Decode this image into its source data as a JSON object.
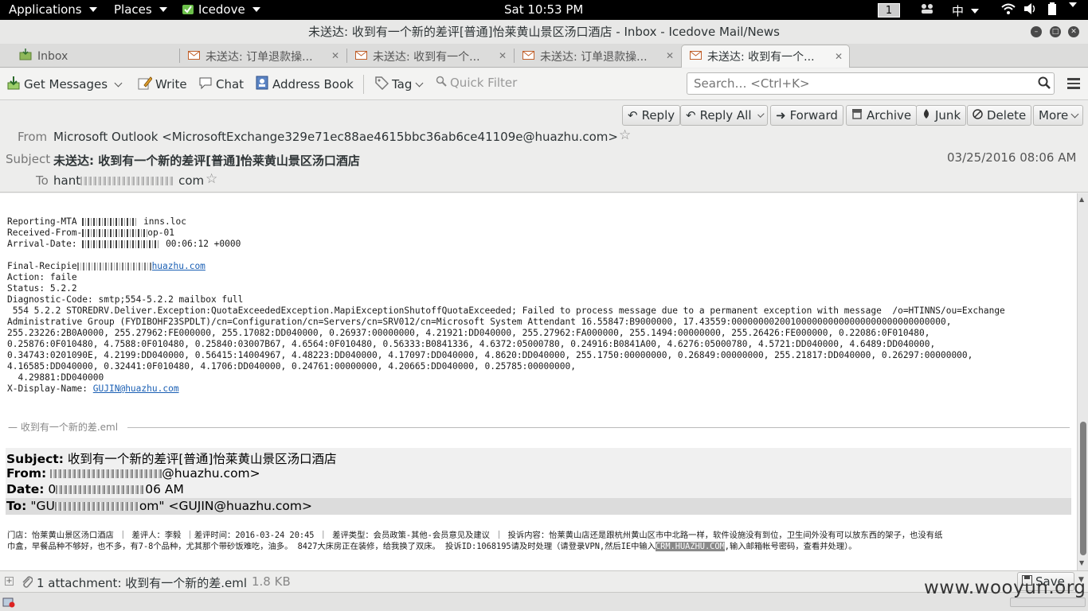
{
  "topbar": {
    "applications": "Applications",
    "places": "Places",
    "app_name": "Icedove",
    "clock": "Sat 10:53 PM",
    "workspace": "1",
    "input_method": "中"
  },
  "window": {
    "title": "未送达: 收到有一个新的差评[普通]怡莱黄山景区汤口酒店 - Inbox - Icedove Mail/News"
  },
  "tabs": [
    {
      "label": "Inbox"
    },
    {
      "label": "未送达: 订单退款操..."
    },
    {
      "label": "未送达: 收到有一个..."
    },
    {
      "label": "未送达: 订单退款操..."
    },
    {
      "label": "未送达: 收到有一个..."
    }
  ],
  "toolbar": {
    "get_messages": "Get Messages",
    "write": "Write",
    "chat": "Chat",
    "address_book": "Address Book",
    "tag": "Tag",
    "quick_filter": "Quick Filter",
    "search_placeholder": "Search… <Ctrl+K>"
  },
  "header_buttons": {
    "reply": "Reply",
    "reply_all": "Reply All",
    "forward": "Forward",
    "archive": "Archive",
    "junk": "Junk",
    "delete": "Delete",
    "more": "More"
  },
  "message_header": {
    "from_label": "From",
    "from_value": "Microsoft Outlook <MicrosoftExchange329e71ec88ae4615bbc36ab6ce41109e@huazhu.com>",
    "subject_label": "Subject",
    "subject_value": "未送达: 收到有一个新的差评[普通]怡莱黄山景区汤口酒店",
    "date": "03/25/2016 08:06 AM",
    "to_label": "To",
    "to_prefix": "hant",
    "to_suffix": "com"
  },
  "body": {
    "reporting_mta": "Reporting-MTA",
    "reporting_mta_tail": "inns.loc",
    "received_from": "Received-From-",
    "received_from_tail": "op-01",
    "arrival_date": "Arrival-Date:",
    "arrival_date_tail": "00:06:12 +0000",
    "final_recipient": "Final-Recipie",
    "final_recipient_link": "huazhu.com",
    "action": "Action: faile",
    "status": "Status: 5.2.2",
    "diagnostic": "Diagnostic-Code: smtp;554-5.2.2 mailbox full",
    "diag_lines": [
      " 554 5.2.2 STOREDRV.Deliver.Exception:QuotaExceededException.MapiExceptionShutoffQuotaExceeded; Failed to process message due to a permanent exception with message  /o=HTINNS/ou=Exchange",
      "Administrative Group (FYDIBOHF23SPDLT)/cn=Configuration/cn=Servers/cn=SRV012/cn=Microsoft System Attendant 16.55847:B9000000, 17.43559:0000000020010000000000000000000000000000,",
      "255.23226:2B0A0000, 255.27962:FE000000, 255.17082:DD040000, 0.26937:00000000, 4.21921:DD040000, 255.27962:FA000000, 255.1494:00000000, 255.26426:FE000000, 0.22086:0F010480,",
      "0.25876:0F010480, 4.7588:0F010480, 0.25840:03007B67, 4.6564:0F010480, 0.56333:B0841336, 4.6372:05000780, 0.24916:B0841A00, 4.6276:05000780, 4.5721:DD040000, 4.6489:DD040000,",
      "0.34743:0201090E, 4.2199:DD040000, 0.56415:14004967, 4.48223:DD040000, 4.17097:DD040000, 4.8620:DD040000, 255.1750:00000000, 0.26849:00000000, 255.21817:DD040000, 0.26297:00000000,",
      "4.16585:DD040000, 0.32441:0F010480, 4.1706:DD040000, 0.24761:00000000, 4.20665:DD040000, 0.25785:00000000,",
      "  4.29881:DD040000"
    ],
    "display_name_label": "X-Display-Name: ",
    "display_name_link": "GUJIN@huazhu.com",
    "attachment_divider": "收到有一个新的差.eml",
    "inner": {
      "subject_label": "Subject:",
      "subject_value": "收到有一个新的差评[普通]怡莱黄山景区汤口酒店",
      "from_label": "From:",
      "from_tail": "@huazhu.com>",
      "date_label": "Date:",
      "date_prefix": "0",
      "date_tail": "06 AM",
      "to_label": "To:",
      "to_prefix": "\"GU",
      "to_tail": "om\" <GUJIN@huazhu.com>"
    },
    "complaint_line1": "门店：怡莱黄山景区汤口酒店 ｜ 差评人：李毅 ｜差评时间：2016-03-24 20:45 ｜ 差评类型：会员政策-其他-会员意见及建议 ｜ 投诉内容：怡莱黄山店还是跟杭州黄山区市中北路一样，软件设施没有到位，卫生间外没有可以放东西的架子，也没有纸",
    "complaint_line2_a": "巾盒，早餐品种不够好，也不多，有7-8个品种，尤其那个带砂饭难吃，油多。 8427大床房正在装修，给我换了双床。 投诉ID:1068195请及时处理（请登录VPN,然后IE中输入",
    "complaint_highlight": "CRM.HUAZHU.COM",
    "complaint_line2_b": ",输入邮箱帐号密码，查看并处理）。"
  },
  "attachment": {
    "label": "1 attachment: 收到有一个新的差.eml",
    "size": "1.8 KB",
    "save": "Save"
  },
  "watermark": "www.wooyun.org"
}
